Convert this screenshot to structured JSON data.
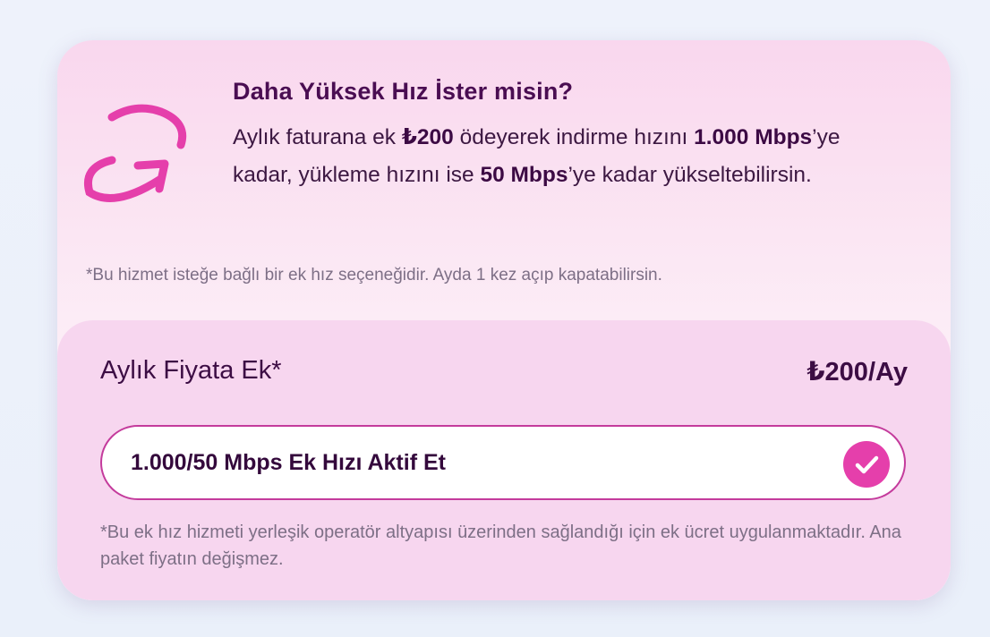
{
  "promo": {
    "title": "Daha Yüksek Hız İster misin?",
    "desc_1": "Aylık faturana ek ",
    "desc_price": "₺200",
    "desc_2": " ödeyerek indirme hızını ",
    "desc_down_speed": "1.000 Mbps",
    "desc_3": "’ye kadar, yükleme hızını ise ",
    "desc_up_speed": "50 Mbps",
    "desc_4": "’ye kadar yükseltebilirsin.",
    "note": "*Bu hizmet isteğe bağlı bir ek hız seçeneğidir. Ayda 1 kez açıp kapatabilirsin.",
    "icon": "speed-upgrade-arrow-icon"
  },
  "pricing": {
    "label": "Aylık Fiyata Ek*",
    "value": "₺200/Ay"
  },
  "toggle": {
    "label": "1.000/50 Mbps Ek Hızı Aktif Et",
    "checked": true,
    "icon": "checkmark-icon"
  },
  "footnote": "*Bu ek hız hizmeti yerleşik operatör altyapısı üzerinden sağlandığı için ek ücret uygulanmaktadır. Ana paket fiyatın değişmez.",
  "colors": {
    "accent": "#e53fab",
    "heading": "#4a0d52",
    "card_bottom": "#f7d6ef"
  }
}
